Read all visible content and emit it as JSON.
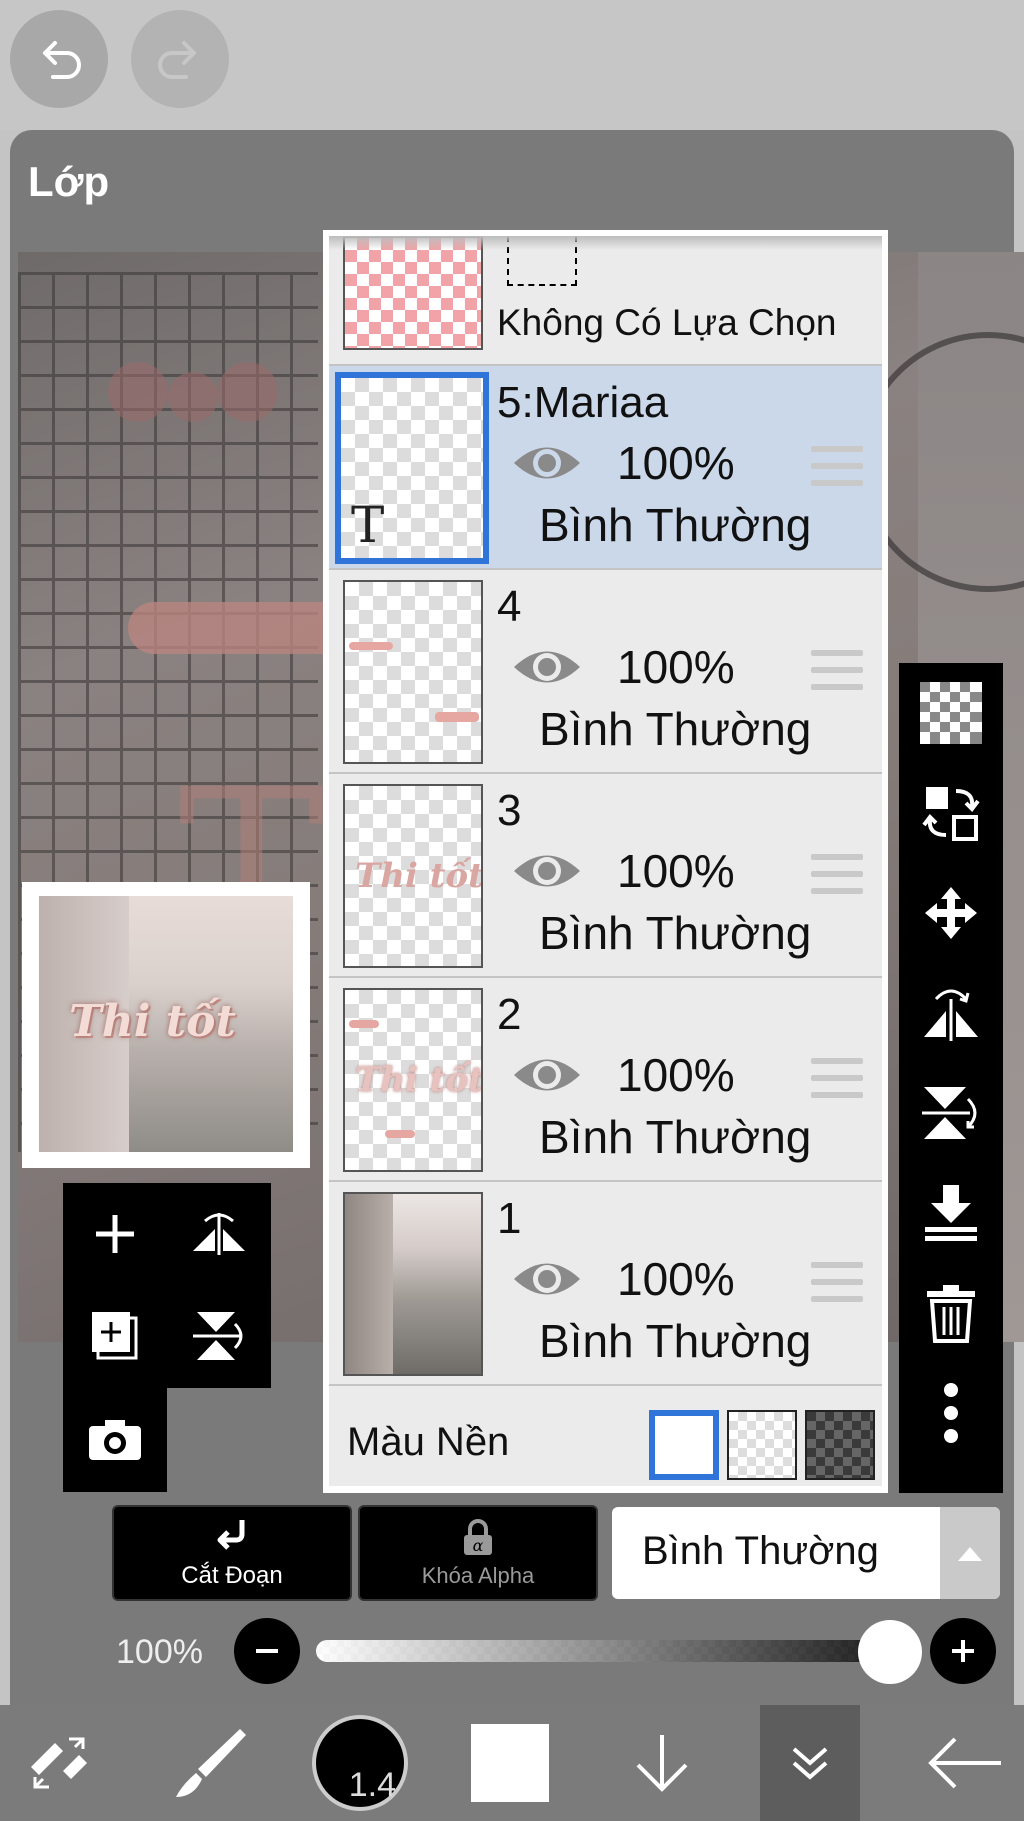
{
  "panel": {
    "title": "Lớp"
  },
  "selection": {
    "label": "Không Có Lựa Chọn"
  },
  "layers": [
    {
      "name": "5:Mariaa",
      "opacity": "100%",
      "blend": "Bình Thường",
      "active": true
    },
    {
      "name": "4",
      "opacity": "100%",
      "blend": "Bình Thường",
      "active": false
    },
    {
      "name": "3",
      "opacity": "100%",
      "blend": "Bình Thường",
      "active": false
    },
    {
      "name": "2",
      "opacity": "100%",
      "blend": "Bình Thường",
      "active": false
    },
    {
      "name": "1",
      "opacity": "100%",
      "blend": "Bình Thường",
      "active": false
    }
  ],
  "layer_thumbs": {
    "layer3_text": "Thi tốt",
    "layer2_text": "Thi tốt",
    "layer5_glyph": "T"
  },
  "canvas_preview": {
    "title_text": "Thi tốt"
  },
  "background": {
    "label": "Màu Nền",
    "selected": "white"
  },
  "actions": {
    "clipping_label": "Cắt Đoạn",
    "alpha_lock_label": "Khóa Alpha"
  },
  "blend_mode": {
    "value": "Bình Thường"
  },
  "opacity": {
    "label": "100%",
    "value": 1.0
  },
  "brush": {
    "size": "1.4"
  },
  "colors": {
    "accent": "#2f74d9",
    "selected_row": "#cbd8ea",
    "panel": "#7a7a7a",
    "toolbar": "#000000"
  },
  "icons": {
    "top": [
      "undo-icon",
      "redo-icon"
    ],
    "left_tools": [
      "add-layer-icon",
      "flip-horizontal-icon",
      "add-copy-layer-icon",
      "flip-vertical-icon",
      "camera-icon"
    ],
    "right_tools": [
      "transparency-icon",
      "swap-layers-icon",
      "move-icon",
      "flip-horizontal-icon",
      "flip-vertical-icon",
      "merge-down-icon",
      "trash-icon",
      "more-icon"
    ],
    "bottom": [
      "transform-tool-icon",
      "brush-icon",
      "brush-size-icon",
      "color-icon",
      "arrow-down-icon",
      "layers-collapse-icon",
      "back-arrow-icon"
    ]
  }
}
